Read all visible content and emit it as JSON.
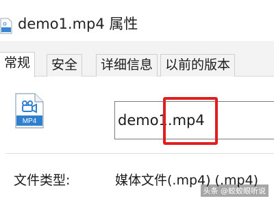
{
  "window": {
    "title": "demo1.mp4 属性"
  },
  "tabs": [
    {
      "label": "常规",
      "active": true
    },
    {
      "label": "安全",
      "active": false
    },
    {
      "label": "详细信息",
      "active": false
    },
    {
      "label": "以前的版本",
      "active": false
    }
  ],
  "general": {
    "file_icon_label": "MP4",
    "file_name_value": "demo1.mp4",
    "file_type_label": "文件类型:",
    "file_type_value": "媒体文件(.mp4) (.mp4)"
  },
  "annotation": {
    "highlight_color": "#e01e1e"
  },
  "watermark": {
    "text": "头条 @蛟蛟眼听说"
  },
  "icons": {
    "title": "video-file-icon",
    "file": "mp4-file-icon"
  }
}
